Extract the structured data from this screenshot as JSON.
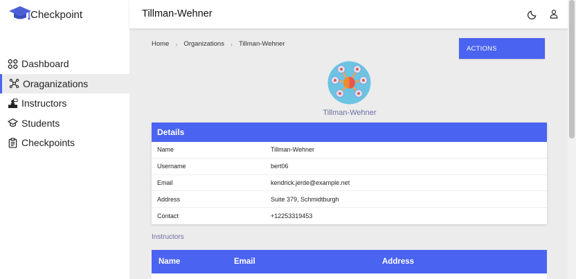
{
  "brand": {
    "name": "Checkpoint",
    "icon": "graduation-cap-icon"
  },
  "sidebar": {
    "items": [
      {
        "label": "Dashboard",
        "icon": "grid-icon",
        "active": false
      },
      {
        "label": "Oraganizations",
        "icon": "network-icon",
        "active": true
      },
      {
        "label": "Instructors",
        "icon": "teacher-icon",
        "active": false
      },
      {
        "label": "Students",
        "icon": "graduation-cap-icon",
        "active": false
      },
      {
        "label": "Checkpoints",
        "icon": "clipboard-icon",
        "active": false
      }
    ]
  },
  "header": {
    "title": "Tillman-Wehner",
    "icons": [
      "moon-icon",
      "user-icon"
    ]
  },
  "breadcrumb": {
    "items": [
      "Home",
      "Organizations",
      "Tillman-Wehner"
    ]
  },
  "actions": {
    "label": "ACTIONS"
  },
  "organization": {
    "name": "Tillman-Wehner"
  },
  "details": {
    "title": "Details",
    "rows": [
      {
        "key": "Name",
        "value": "Tillman-Wehner"
      },
      {
        "key": "Username",
        "value": "bert06"
      },
      {
        "key": "Email",
        "value": "kendrick.jerde@example.net"
      },
      {
        "key": "Address",
        "value": "Suite 379, Schmidtburgh"
      },
      {
        "key": "Contact",
        "value": "+12253319453"
      }
    ]
  },
  "instructors": {
    "label": "Instructors",
    "columns": [
      "Name",
      "Email",
      "Address"
    ]
  },
  "colors": {
    "accent": "#4a63f0",
    "background": "#ececec",
    "muted_text": "#6c6fa0"
  }
}
